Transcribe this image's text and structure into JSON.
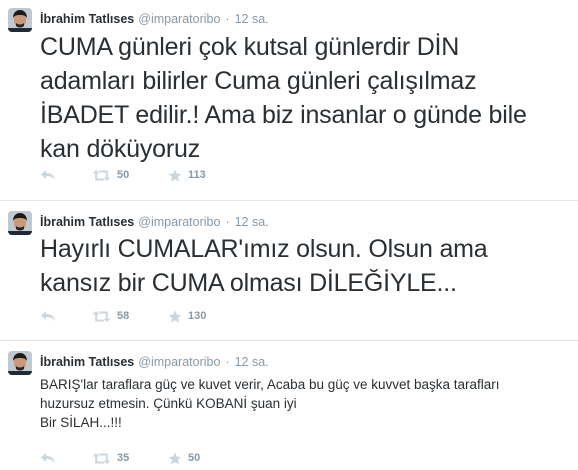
{
  "tweets": [
    {
      "fullname": "İbrahim Tatlıses",
      "handle": "@imparatoribo",
      "separator": "·",
      "time": "12 sa.",
      "text_lines": [
        "CUMA günleri çok kutsal günlerdir DİN",
        "adamları bilirler Cuma günleri çalışılmaz",
        "İBADET edilir.! Ama biz insanlar o günde bile",
        "kan döküyoruz"
      ],
      "retweets": "50",
      "favorites": "113"
    },
    {
      "fullname": "İbrahim Tatlıses",
      "handle": "@imparatoribo",
      "separator": "·",
      "time": "12 sa.",
      "text_lines": [
        "Hayırlı CUMALAR'ımız olsun. Olsun ama",
        "kansız bir CUMA olması DİLEĞİYLE..."
      ],
      "retweets": "58",
      "favorites": "130"
    },
    {
      "fullname": "İbrahim Tatlıses",
      "handle": "@imparatoribo",
      "separator": "·",
      "time": "12 sa.",
      "text_lines": [
        "BARIŞ'lar taraflara güç ve kuvet verir, Acaba bu güç ve kuvvet başka tarafları",
        "huzursuz etmesin. Çünkü KOBANİ şuan iyi",
        "Bir SİLAH...!!!"
      ],
      "retweets": "35",
      "favorites": "50"
    }
  ],
  "colors": {
    "text": "#292f33",
    "meta": "#8899a6",
    "icon": "#ccd6dd",
    "divider": "#e1e8ed"
  },
  "icons": {
    "reply": "reply-arrow",
    "retweet": "retweet-arrows",
    "favorite": "star"
  }
}
